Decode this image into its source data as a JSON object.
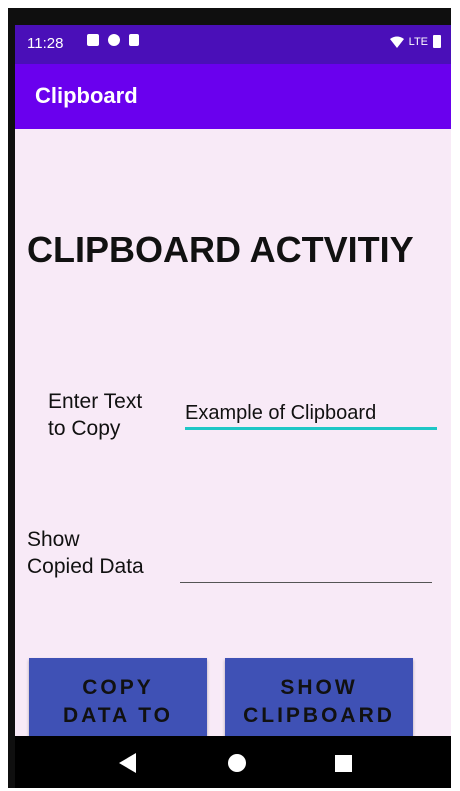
{
  "status_bar": {
    "time": "11:28",
    "network": "LTE"
  },
  "app_bar": {
    "title": "Clipboard"
  },
  "main": {
    "heading": "CLIPBOARD ACTVITIY",
    "enter_label_line1": "Enter Text",
    "enter_label_line2": "to Copy",
    "input_value": "Example of Clipboard",
    "show_label_line1": "Show",
    "show_label_line2": "Copied Data",
    "copied_value": ""
  },
  "buttons": {
    "copy_line1": "COPY",
    "copy_line2": "DATA TO",
    "show_line1": "SHOW",
    "show_line2": "CLIPBOARD"
  },
  "colors": {
    "status_bar": "#4a0fb8",
    "app_bar": "#6a00ee",
    "background": "#f8eaf7",
    "button": "#3f51b5",
    "input_underline": "#1fc6c6"
  },
  "icons": [
    "message-icon",
    "data-saver-icon",
    "sd-card-icon",
    "wifi-icon",
    "battery-icon",
    "back-icon",
    "home-icon",
    "recents-icon"
  ]
}
